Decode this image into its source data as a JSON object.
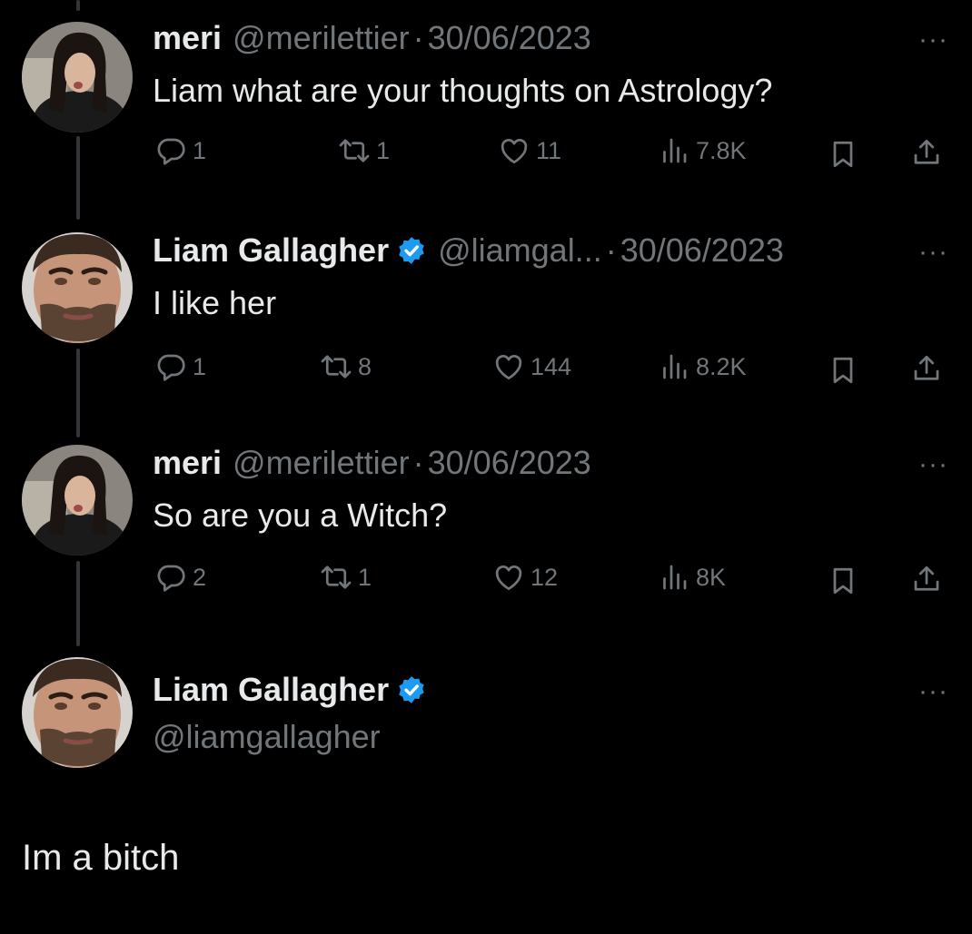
{
  "tweets": [
    {
      "name": "meri",
      "handle": "@merilettier",
      "sep": "·",
      "date": "30/06/2023",
      "text": "Liam what are your thoughts on Astrology?",
      "replies": "1",
      "retweets": "1",
      "likes": "11",
      "views": "7.8K",
      "verified": false
    },
    {
      "name": "Liam Gallagher",
      "handle": "@liamgal...",
      "sep": "·",
      "date": "30/06/2023",
      "text": "I like her",
      "replies": "1",
      "retweets": "8",
      "likes": "144",
      "views": "8.2K",
      "verified": true
    },
    {
      "name": "meri",
      "handle": "@merilettier",
      "sep": "·",
      "date": "30/06/2023",
      "text": "So are you a Witch?",
      "replies": "2",
      "retweets": "1",
      "likes": "12",
      "views": "8K",
      "verified": false
    }
  ],
  "main_tweet": {
    "name": "Liam Gallagher",
    "handle": "@liamgallagher",
    "text": "Im a bitch",
    "verified": true
  },
  "ui": {
    "more_glyph": "···"
  },
  "colors": {
    "background": "#000000",
    "primary_text": "#e7e9ea",
    "secondary_text": "#71767b",
    "verified_blue": "#1d9bf0",
    "thread_line": "#333639"
  },
  "icons": [
    "reply-icon",
    "retweet-icon",
    "like-icon",
    "views-icon",
    "bookmark-icon",
    "share-icon",
    "more-icon",
    "verified-badge-icon"
  ]
}
